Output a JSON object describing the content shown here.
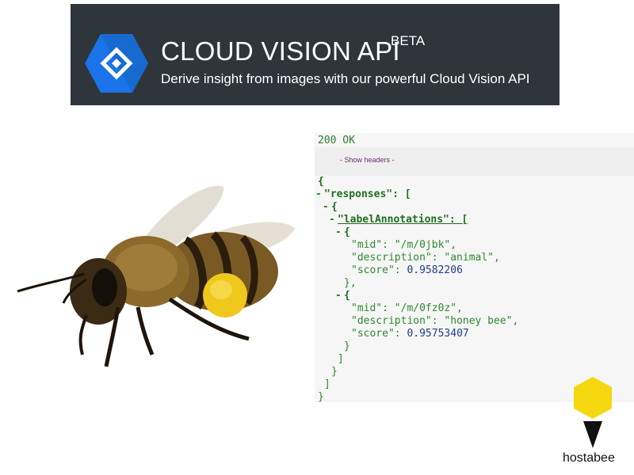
{
  "banner": {
    "title": "CLOUD VISION API",
    "badge": "BETA",
    "subtitle": "Derive insight from images with our powerful Cloud Vision API"
  },
  "response": {
    "status": "200 OK",
    "show_headers": "- Show headers -",
    "lines": [
      "{",
      "\"responses\": [",
      "{",
      "\"labelAnnotations\": [",
      "{",
      "\"mid\": \"/m/0jbk\",",
      "\"description\": \"animal\",",
      "\"score\": 0.9582206",
      "},",
      "{",
      "\"mid\": \"/m/0fz0z\",",
      "\"description\": \"honey bee\",",
      "\"score\": 0.95753407",
      "}",
      "]",
      "}",
      "]",
      "}"
    ]
  },
  "brand": {
    "name": "hostabee"
  },
  "colors": {
    "banner_bg": "#2e363c",
    "logo_blue": "#1565c0",
    "json_green": "#2f8a2f",
    "hex_yellow": "#f5d80f"
  }
}
